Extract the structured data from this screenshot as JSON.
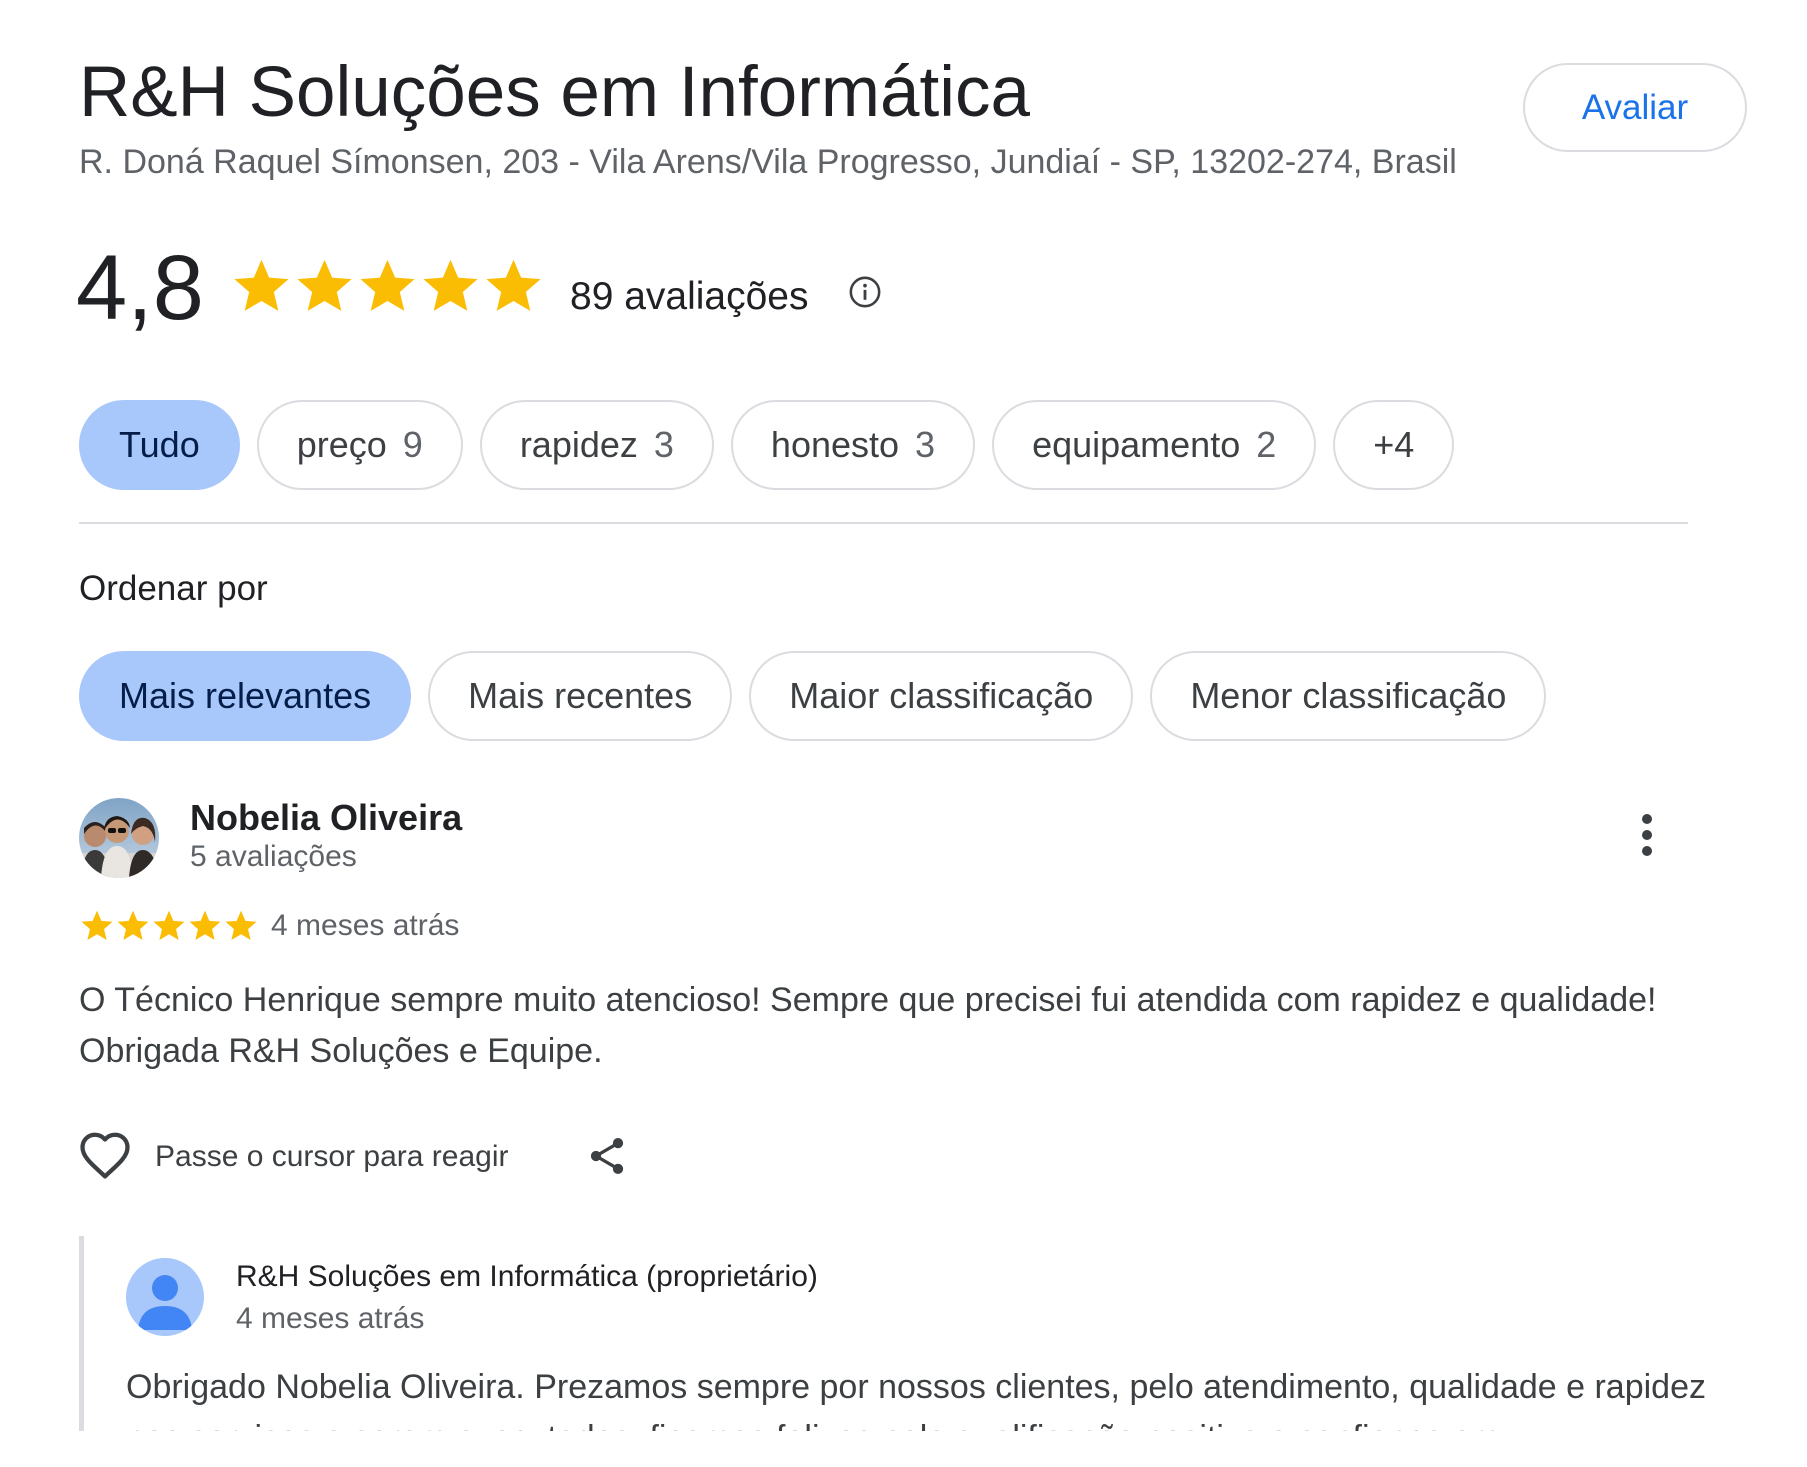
{
  "place": {
    "name": "R&H Soluções em Informática",
    "address": "R. Doná Raquel Símonsen, 203 - Vila Arens/Vila Progresso, Jundiaí - SP, 13202-274, Brasil",
    "rate_button_label": "Avaliar"
  },
  "summary": {
    "rating": "4,8",
    "rating_value": 4.8,
    "stars_filled": 5,
    "review_count_label": "89 avaliações",
    "info_icon": "info-icon"
  },
  "topics": [
    {
      "label": "Tudo",
      "count": "",
      "active": true
    },
    {
      "label": "preço",
      "count": "9",
      "active": false
    },
    {
      "label": "rapidez",
      "count": "3",
      "active": false
    },
    {
      "label": "honesto",
      "count": "3",
      "active": false
    },
    {
      "label": "equipamento",
      "count": "2",
      "active": false
    },
    {
      "label": "+4",
      "count": "",
      "active": false
    }
  ],
  "sort": {
    "label": "Ordenar por",
    "options": [
      {
        "label": "Mais relevantes",
        "active": true
      },
      {
        "label": "Mais recentes",
        "active": false
      },
      {
        "label": "Maior classificação",
        "active": false
      },
      {
        "label": "Menor classificação",
        "active": false
      }
    ]
  },
  "review": {
    "author": "Nobelia Oliveira",
    "author_reviews": "5 avaliações",
    "stars": 5,
    "time": "4 meses atrás",
    "text": "O Técnico Henrique sempre muito atencioso! Sempre que precisei fui atendida com rapidez e qualidade! Obrigada R&H Soluções e Equipe.",
    "react_label": "Passe o cursor para reagir",
    "icons": [
      "more-vert-icon",
      "heart-icon",
      "share-icon"
    ]
  },
  "owner_reply": {
    "name": "R&H Soluções em Informática (proprietário)",
    "time": "4 meses atrás",
    "text": "Obrigado Nobelia Oliveira. Prezamos sempre por nossos clientes, pelo atendimento, qualidade e rapidez nos serviços a serem executados, ficamos felizes pela qualificação positiva e confiança em"
  },
  "colors": {
    "star": "#fbbc04",
    "accent": "#1a73e8",
    "active_chip": "#a8c7fa",
    "owner_avatar_bg": "#a8c7fa",
    "owner_avatar_fg": "#4285f4"
  }
}
